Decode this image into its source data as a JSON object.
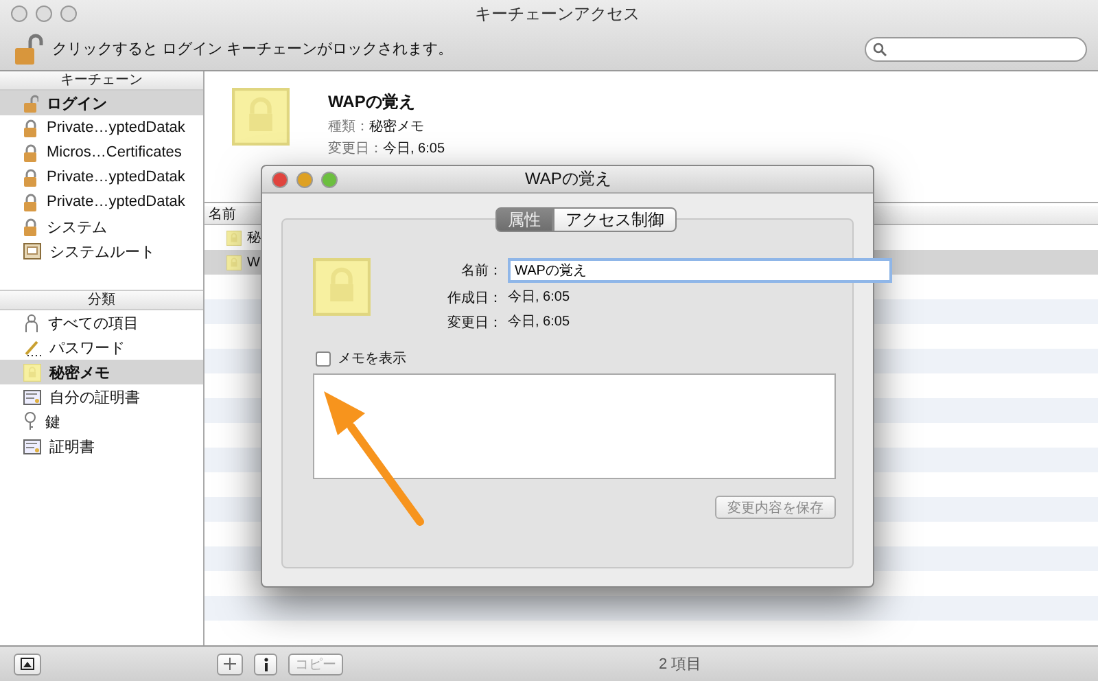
{
  "window": {
    "title": "キーチェーンアクセス",
    "lock_message": "クリックすると ログイン キーチェーンがロックされます。"
  },
  "keychains": {
    "header": "キーチェーン",
    "items": [
      {
        "label": "ログイン",
        "kind": "open-lock",
        "selected": true
      },
      {
        "label": "Private…yptedDatak",
        "kind": "lock",
        "selected": false
      },
      {
        "label": "Micros…Certificates",
        "kind": "lock",
        "selected": false
      },
      {
        "label": "Private…yptedDatak",
        "kind": "lock",
        "selected": false
      },
      {
        "label": "Private…yptedDatak",
        "kind": "lock",
        "selected": false
      },
      {
        "label": "システム",
        "kind": "lock",
        "selected": false
      },
      {
        "label": "システムルート",
        "kind": "cabinet",
        "selected": false
      }
    ]
  },
  "categories": {
    "header": "分類",
    "items": [
      {
        "label": "すべての項目",
        "kind": "people",
        "selected": false
      },
      {
        "label": "パスワード",
        "kind": "pen",
        "selected": false
      },
      {
        "label": "秘密メモ",
        "kind": "note",
        "selected": true
      },
      {
        "label": "自分の証明書",
        "kind": "certificate",
        "selected": false
      },
      {
        "label": "鍵",
        "kind": "key",
        "selected": false
      },
      {
        "label": "証明書",
        "kind": "certificate",
        "selected": false
      }
    ]
  },
  "info": {
    "title": "WAPの覚え",
    "kind_label": "種類：",
    "kind_value": "秘密メモ",
    "modified_label": "変更日：",
    "modified_value": "今日, 6:05"
  },
  "table": {
    "columns": [
      "名前"
    ],
    "rows": [
      {
        "name": "秘",
        "selected": false
      },
      {
        "name": "W",
        "selected": true
      }
    ]
  },
  "dialog": {
    "title": "WAPの覚え",
    "tabs": [
      {
        "label": "属性",
        "selected": true
      },
      {
        "label": "アクセス制御",
        "selected": false
      }
    ],
    "name_label": "名前：",
    "name_value": "WAPの覚え",
    "created_label": "作成日：",
    "created_value": "今日, 6:05",
    "modified_label": "変更日：",
    "modified_value": "今日, 6:05",
    "show_note": {
      "label": "メモを表示",
      "checked": false
    },
    "save_button": {
      "label": "変更内容を保存",
      "disabled": true
    }
  },
  "bottom_bar": {
    "copy_button": {
      "label": "コピー",
      "disabled": true
    },
    "status": "2 項目"
  }
}
